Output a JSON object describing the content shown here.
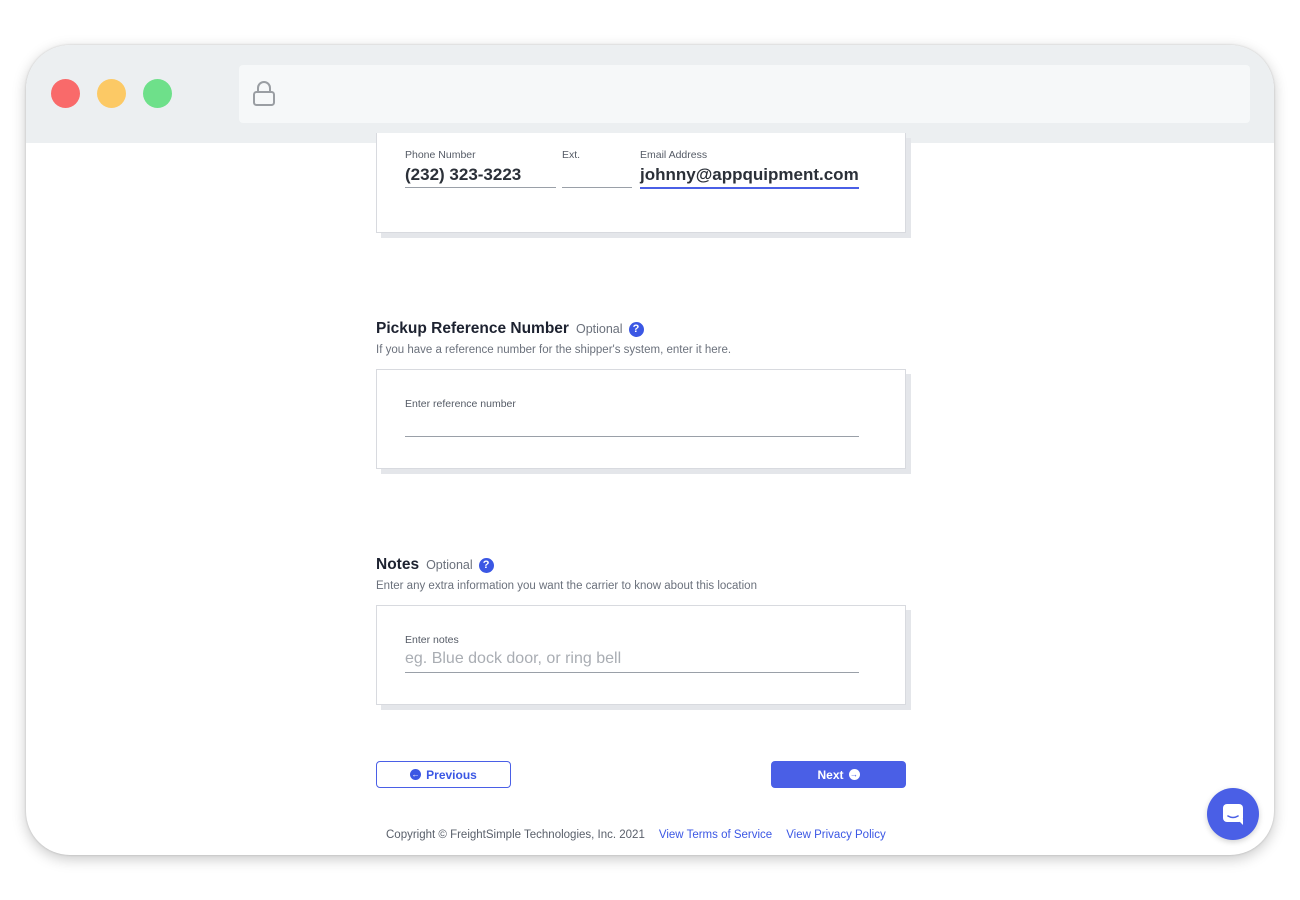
{
  "window": {
    "controls": [
      "close",
      "minimize",
      "maximize"
    ],
    "address_icon": "lock-icon"
  },
  "contact": {
    "phone_label": "Phone Number",
    "phone_value": "(232) 323-3223",
    "ext_label": "Ext.",
    "ext_value": "",
    "email_label": "Email Address",
    "email_value": "johnny@appquipment.com"
  },
  "reference": {
    "title": "Pickup Reference Number",
    "optional": "Optional",
    "help": "?",
    "description": "If you have a reference number for the shipper's system, enter it here.",
    "field_label": "Enter reference number",
    "field_value": ""
  },
  "notes": {
    "title": "Notes",
    "optional": "Optional",
    "help": "?",
    "description": "Enter any extra information you want the carrier to know about this location",
    "field_label": "Enter notes",
    "placeholder": "eg. Blue dock door, or ring bell"
  },
  "nav": {
    "previous_label": "Previous",
    "next_label": "Next",
    "previous_icon": "←",
    "next_icon": "→"
  },
  "footer": {
    "copyright": "Copyright © FreightSimple Technologies, Inc. 2021",
    "terms_link": "View Terms of Service",
    "privacy_link": "View Privacy Policy"
  },
  "colors": {
    "accent": "#4a5fe6",
    "window_chrome": "#eceff1",
    "close": "#f96a6a",
    "minimize": "#fcc965",
    "maximize": "#6ee08a"
  },
  "chat": {
    "icon": "chat-icon"
  }
}
